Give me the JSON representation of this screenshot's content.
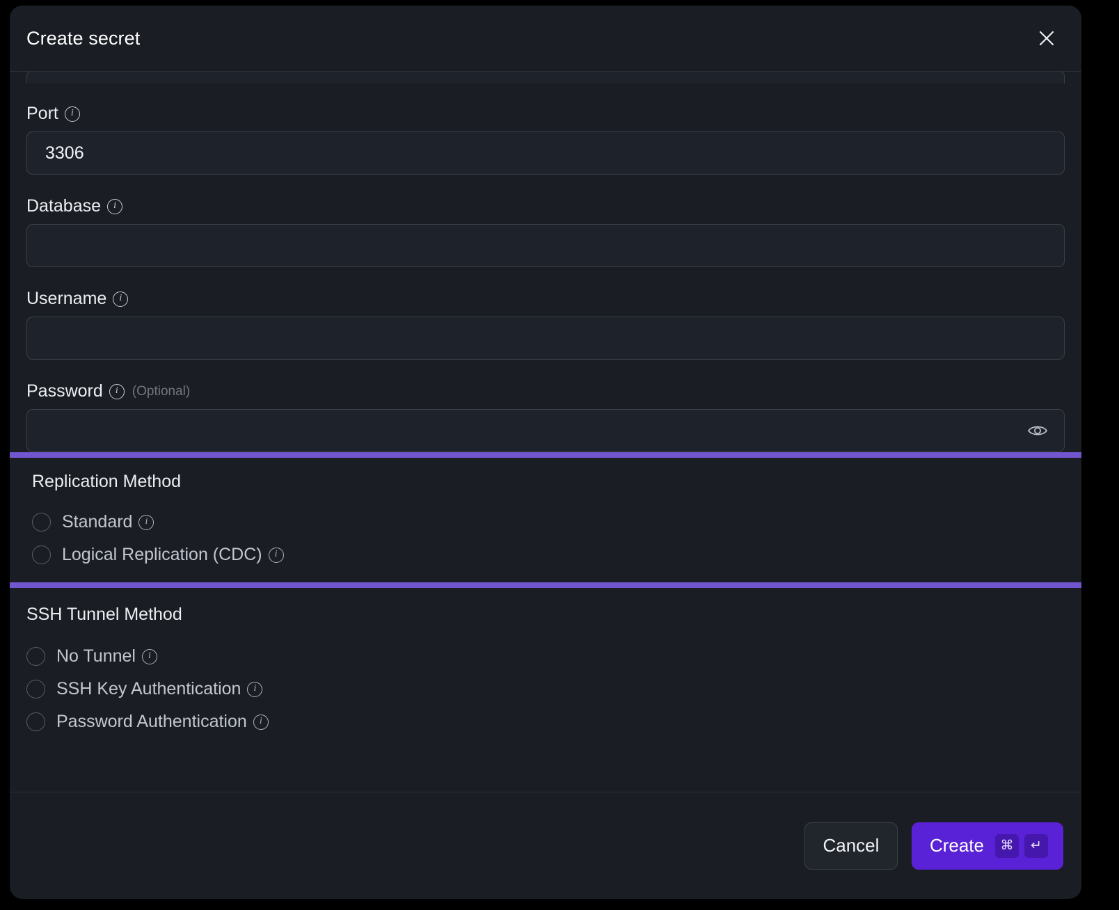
{
  "dialog": {
    "title": "Create secret",
    "close_icon": "close-icon"
  },
  "fields": [
    {
      "label": "Port",
      "info_icon": "info-icon",
      "value": "3306",
      "placeholder": "",
      "optional": "",
      "type": "text"
    },
    {
      "label": "Database",
      "info_icon": "info-icon",
      "value": "",
      "placeholder": "",
      "optional": "",
      "type": "text"
    },
    {
      "label": "Username",
      "info_icon": "info-icon",
      "value": "",
      "placeholder": "",
      "optional": "",
      "type": "text"
    },
    {
      "label": "Password",
      "info_icon": "info-icon",
      "value": "",
      "placeholder": "",
      "optional": "(Optional)",
      "type": "password",
      "reveal_icon": "eye-icon"
    }
  ],
  "replication": {
    "title": "Replication Method",
    "highlighted": true,
    "highlight_color": "#7156cf",
    "options": [
      {
        "label": "Standard",
        "info_icon": "info-icon",
        "selected": false
      },
      {
        "label": "Logical Replication (CDC)",
        "info_icon": "info-icon",
        "selected": false
      }
    ]
  },
  "ssh": {
    "title": "SSH Tunnel Method",
    "options": [
      {
        "label": "No Tunnel",
        "info_icon": "info-icon",
        "selected": false
      },
      {
        "label": "SSH Key Authentication",
        "info_icon": "info-icon",
        "selected": false
      },
      {
        "label": "Password Authentication",
        "info_icon": "info-icon",
        "selected": false
      }
    ]
  },
  "footer": {
    "cancel_label": "Cancel",
    "create_label": "Create",
    "shortcut_keys": [
      "⌘",
      "↵"
    ],
    "create_color": "#5a22d6"
  }
}
